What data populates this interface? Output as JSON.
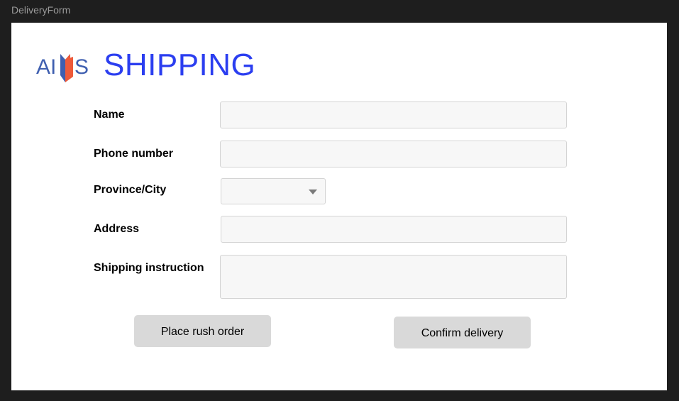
{
  "window": {
    "frame_title": "DeliveryForm"
  },
  "header": {
    "logo_text": "AIMS",
    "title": "SHIPPING"
  },
  "form": {
    "name": {
      "label": "Name",
      "value": ""
    },
    "phone": {
      "label": "Phone number",
      "value": ""
    },
    "province": {
      "label": "Province/City",
      "selected": ""
    },
    "address": {
      "label": "Address",
      "value": ""
    },
    "instruction": {
      "label": "Shipping instruction",
      "value": ""
    }
  },
  "actions": {
    "rush_label": "Place rush order",
    "confirm_label": "Confirm delivery"
  },
  "colors": {
    "title": "#2b3ef0",
    "logo_blue": "#3f5fb0",
    "logo_orange": "#ee5a3a",
    "button_bg": "#d9d9d9",
    "input_bg": "#f7f7f7"
  }
}
